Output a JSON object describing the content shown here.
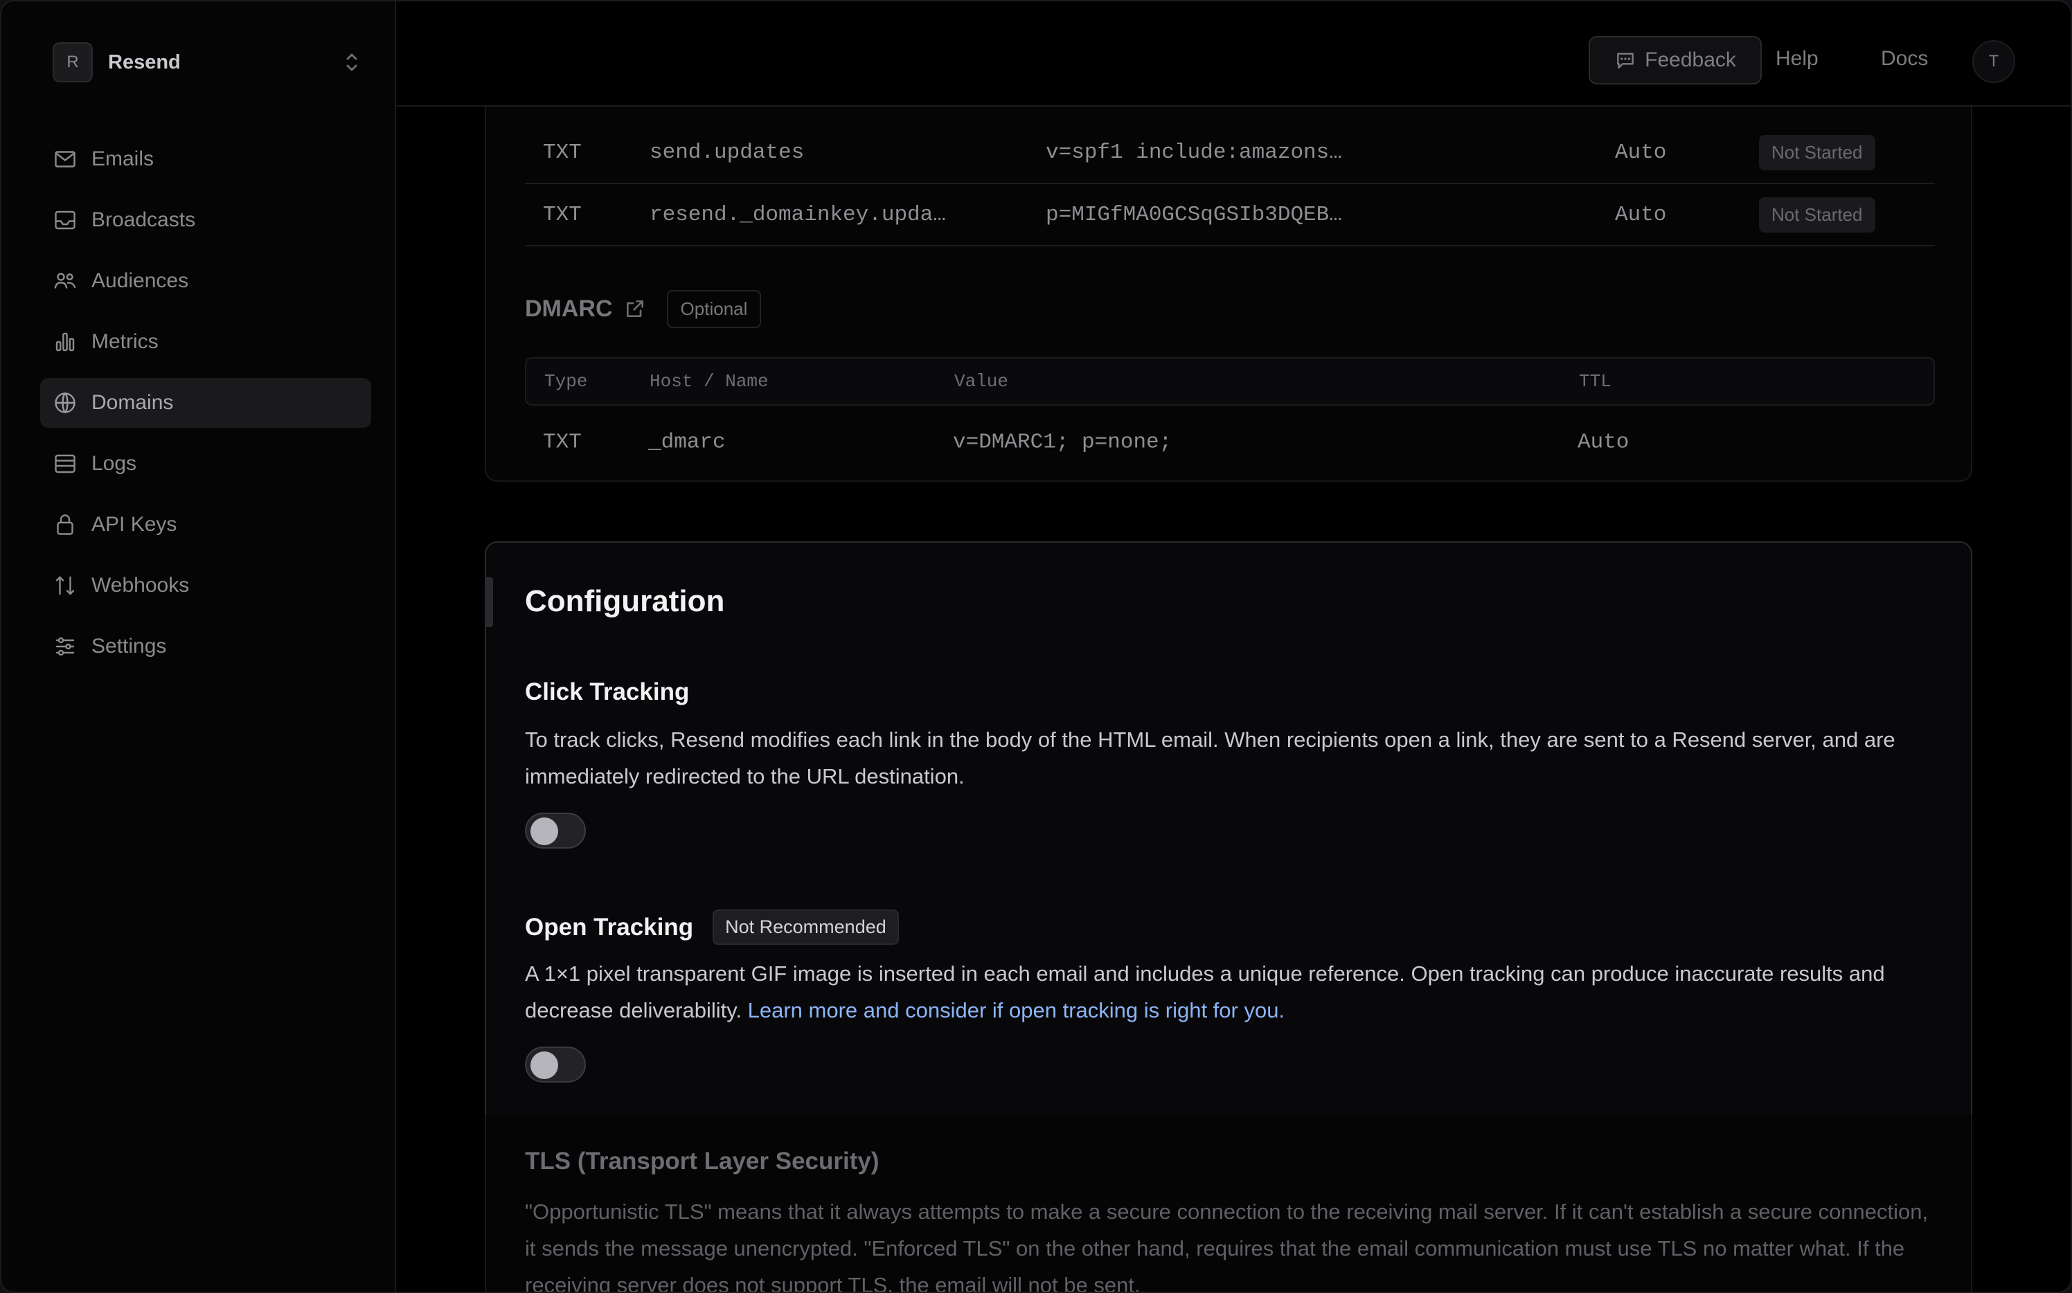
{
  "team": {
    "initial": "R",
    "name": "Resend"
  },
  "nav": {
    "items": [
      {
        "label": "Emails",
        "icon": "mail-icon"
      },
      {
        "label": "Broadcasts",
        "icon": "inbox-icon"
      },
      {
        "label": "Audiences",
        "icon": "users-icon"
      },
      {
        "label": "Metrics",
        "icon": "bar-chart-icon"
      },
      {
        "label": "Domains",
        "icon": "globe-icon",
        "active": true
      },
      {
        "label": "Logs",
        "icon": "logs-icon"
      },
      {
        "label": "API Keys",
        "icon": "lock-icon"
      },
      {
        "label": "Webhooks",
        "icon": "webhook-icon"
      },
      {
        "label": "Settings",
        "icon": "sliders-icon"
      }
    ]
  },
  "topbar": {
    "feedback": "Feedback",
    "help": "Help",
    "docs": "Docs",
    "avatar_initial": "T"
  },
  "records": {
    "rows": [
      {
        "type": "TXT",
        "host": "send.updates",
        "value": "v=spf1 include:amazons…",
        "ttl": "Auto",
        "status": "Not Started"
      },
      {
        "type": "TXT",
        "host": "resend._domainkey.upda…",
        "value": "p=MIGfMA0GCSqGSIb3DQEB…",
        "ttl": "Auto",
        "status": "Not Started"
      }
    ]
  },
  "dmarc": {
    "title": "DMARC",
    "badge": "Optional",
    "headers": {
      "type": "Type",
      "host": "Host / Name",
      "value": "Value",
      "ttl": "TTL"
    },
    "row": {
      "type": "TXT",
      "host": "_dmarc",
      "value": "v=DMARC1; p=none;",
      "ttl": "Auto"
    }
  },
  "config": {
    "title": "Configuration",
    "click_tracking": {
      "title": "Click Tracking",
      "description": "To track clicks, Resend modifies each link in the body of the HTML email. When recipients open a link, they are sent to a Resend server, and are immediately redirected to the URL destination.",
      "enabled": false
    },
    "open_tracking": {
      "title": "Open Tracking",
      "badge": "Not Recommended",
      "description": "A 1×1 pixel transparent GIF image is inserted in each email and includes a unique reference. Open tracking can produce inaccurate results and decrease deliverability. ",
      "link": "Learn more and consider if open tracking is right for you.",
      "enabled": false
    },
    "tls": {
      "title": "TLS (Transport Layer Security)",
      "description": "\"Opportunistic TLS\" means that it always attempts to make a secure connection to the receiving mail server. If it can't establish a secure connection, it sends the message unencrypted. \"Enforced TLS\" on the other hand, requires that the email communication must use TLS no matter what. If the receiving server does not support TLS, the email will not be sent."
    }
  }
}
